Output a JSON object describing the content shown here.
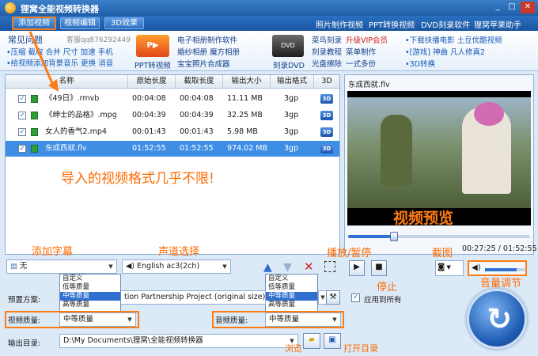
{
  "window": {
    "title": "狸窝全能视频转换器"
  },
  "toolbar": {
    "add_video": "添加视频",
    "edit_video": "视频编辑",
    "effect_3d": "3D效果",
    "links": [
      "照片制作视频",
      "PPT转换视频",
      "DVD刻录软件",
      "狸窝苹果助手"
    ]
  },
  "promo": {
    "faq_title": "常见问题",
    "qq": "客服qq876292449",
    "faq_line1": "•压缩 截取 合并 尺寸 加速 手机",
    "faq_line2": "•给视频添加背景音乐 更换 消音",
    "ppt_label": "PPT转视频",
    "col2": [
      "电子相册制作软件",
      "婚纱相册  魔方相册",
      "宝宝照片合成器"
    ],
    "dvd_label": "刻录DVD",
    "col3a": [
      "菜鸟刻录",
      "刻录教程",
      "光盘擦除"
    ],
    "col3b": [
      "升级VIP会员",
      "菜单制作",
      "一式多份"
    ],
    "col4": [
      "•下载抉播电影 土豆优酷视频",
      "•[游戏] 神曲  凡人修真2",
      "•3D转换"
    ]
  },
  "table": {
    "headers": [
      "名称",
      "原始长度",
      "截取长度",
      "输出大小",
      "输出格式",
      "3D"
    ],
    "rows": [
      {
        "name": "《49日》.rmvb",
        "orig": "00:04:08",
        "cut": "00:04:08",
        "size": "11.11 MB",
        "fmt": "3gp",
        "badge": "3D"
      },
      {
        "name": "《绅士的品格》.mpg",
        "orig": "00:04:39",
        "cut": "00:04:39",
        "size": "32.25 MB",
        "fmt": "3gp",
        "badge": "3D"
      },
      {
        "name": "女人的香气2.mp4",
        "orig": "00:01:43",
        "cut": "00:01:43",
        "size": "5.98 MB",
        "fmt": "3gp",
        "badge": "3D"
      },
      {
        "name": "东成西就.flv",
        "orig": "01:52:55",
        "cut": "01:52:55",
        "size": "974.02 MB",
        "fmt": "3gp",
        "badge": "3D"
      }
    ]
  },
  "annotations": {
    "import_note": "导入的视频格式几乎不限!",
    "video_preview": "视频预览",
    "add_subtitle": "添加字幕",
    "audio_select": "声道选择",
    "play_pause": "播放/暂停",
    "stop": "停止",
    "screenshot": "截图",
    "volume": "音量调节",
    "browse": "浏览",
    "open_dir": "打开目录"
  },
  "preview": {
    "filename": "东成西就.flv",
    "time": "00:27:25 / 01:52:55",
    "progress": 0.25,
    "volume": 0.8
  },
  "subtitle_combo": {
    "value": "无"
  },
  "audio_combo": {
    "value": "English ac3(2ch)"
  },
  "quality_options": [
    "自定义",
    "低等质量",
    "中等质量",
    "高等质量"
  ],
  "quality_selected_index": 2,
  "preset": {
    "label": "预置方案:",
    "value": "tion Partnership Project (original size)"
  },
  "apply_all": "应用到所有",
  "video_quality": {
    "label": "视频质量:",
    "value": "中等质量"
  },
  "audio_quality": {
    "label": "音频质量:",
    "value": "中等质量"
  },
  "output": {
    "label": "输出目录:",
    "path": "D:\\My Documents\\狸窝\\全能视频转换器"
  },
  "colors": {
    "accent": "#2f6fd0",
    "annotation": "#ff6a00"
  }
}
